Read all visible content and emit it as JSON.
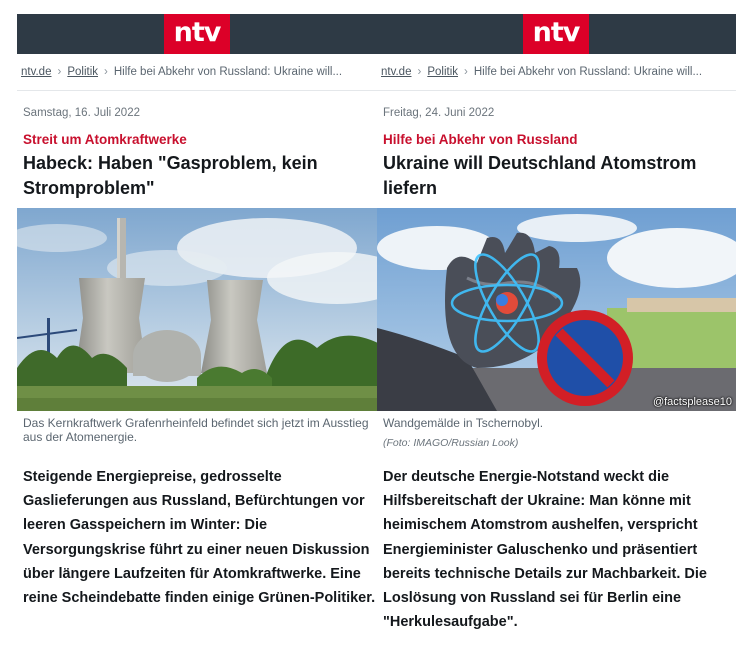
{
  "brand": {
    "logo_text": "ntv",
    "color": "#dc0028",
    "topbar_color": "#2e3a45"
  },
  "articles": [
    {
      "breadcrumb": {
        "home": "ntv.de",
        "section": "Politik",
        "current": "Hilfe bei Abkehr von Russland: Ukraine will..."
      },
      "date": "Samstag, 16. Juli 2022",
      "kicker": "Streit um Atomkraftwerke",
      "headline": "Habeck: Haben \"Gasproblem, kein Stromproblem\"",
      "image_caption": "Das Kernkraftwerk Grafenrheinfeld befindet sich jetzt im Ausstieg aus der Atomenergie.",
      "lead": "Steigende Energiepreise, gedrosselte Gaslieferungen aus Russland, Befürchtungen vor leeren Gasspeichern im Winter: Die Versorgungskrise führt zu einer neuen Diskussion über längere Laufzeiten für Atomkraftwerke. Eine reine Scheindebatte finden einige Grünen-Politiker."
    },
    {
      "breadcrumb": {
        "home": "ntv.de",
        "section": "Politik",
        "current": "Hilfe bei Abkehr von Russland: Ukraine will..."
      },
      "date": "Freitag, 24. Juni 2022",
      "kicker": "Hilfe bei Abkehr von Russland",
      "headline": "Ukraine will Deutschland Atomstrom liefern",
      "image_caption": "Wandgemälde in Tschernobyl.",
      "image_credit": "(Foto: IMAGO/Russian Look)",
      "watermark": "@factsplease10",
      "lead": "Der deutsche Energie-Notstand weckt die Hilfsbereitschaft der Ukraine: Man könne mit heimischem Atomstrom aushelfen, verspricht Energieminister Galuschenko und präsentiert bereits technische Details zur Machbarkeit. Die Loslösung von Russland sei für Berlin eine \"Herkulesaufgabe\"."
    }
  ]
}
